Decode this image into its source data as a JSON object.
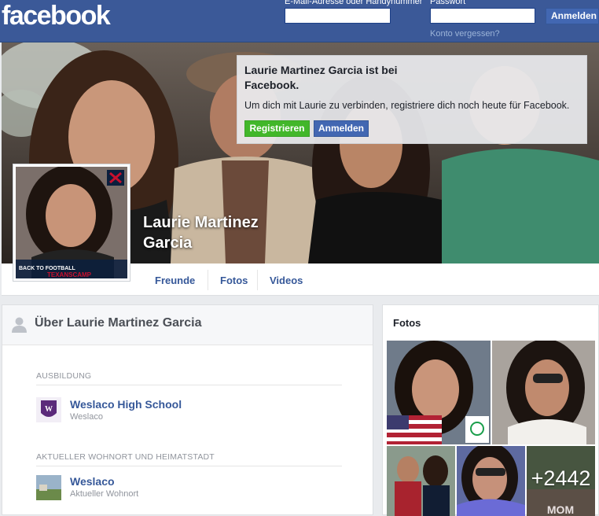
{
  "header": {
    "logo": "facebook",
    "email_label": "E-Mail-Adresse oder Handynummer",
    "password_label": "Passwort",
    "login_button": "Anmelden",
    "forgot_link": "Konto vergessen?"
  },
  "profile": {
    "name_line1": "Laurie Martinez",
    "name_line2": "Garcia",
    "pic_caption": "BACK TO FOOTBALL",
    "pic_caption2": "TEXANSCAMP"
  },
  "popup": {
    "title": "Laurie Martinez Garcia ist bei Facebook.",
    "text": "Um dich mit Laurie zu verbinden, registriere dich noch heute für Facebook.",
    "register_button": "Registrieren",
    "login_button": "Anmelden"
  },
  "tabs": [
    {
      "label": "Freunde"
    },
    {
      "label": "Fotos"
    },
    {
      "label": "Videos"
    }
  ],
  "about": {
    "title": "Über Laurie Martinez Garcia",
    "education_label": "AUSBILDUNG",
    "school_name": "Weslaco High School",
    "school_location": "Weslaco",
    "residence_label": "AKTUELLER WOHNORT UND HEIMATSTADT",
    "city_name": "Weslaco",
    "city_sub": "Aktueller Wohnort"
  },
  "photos": {
    "title": "Fotos",
    "more_count": "+2442",
    "more_caption": "MOM"
  },
  "colors": {
    "brand_blue": "#3b5998",
    "link_blue": "#365899",
    "green": "#42b72a"
  }
}
